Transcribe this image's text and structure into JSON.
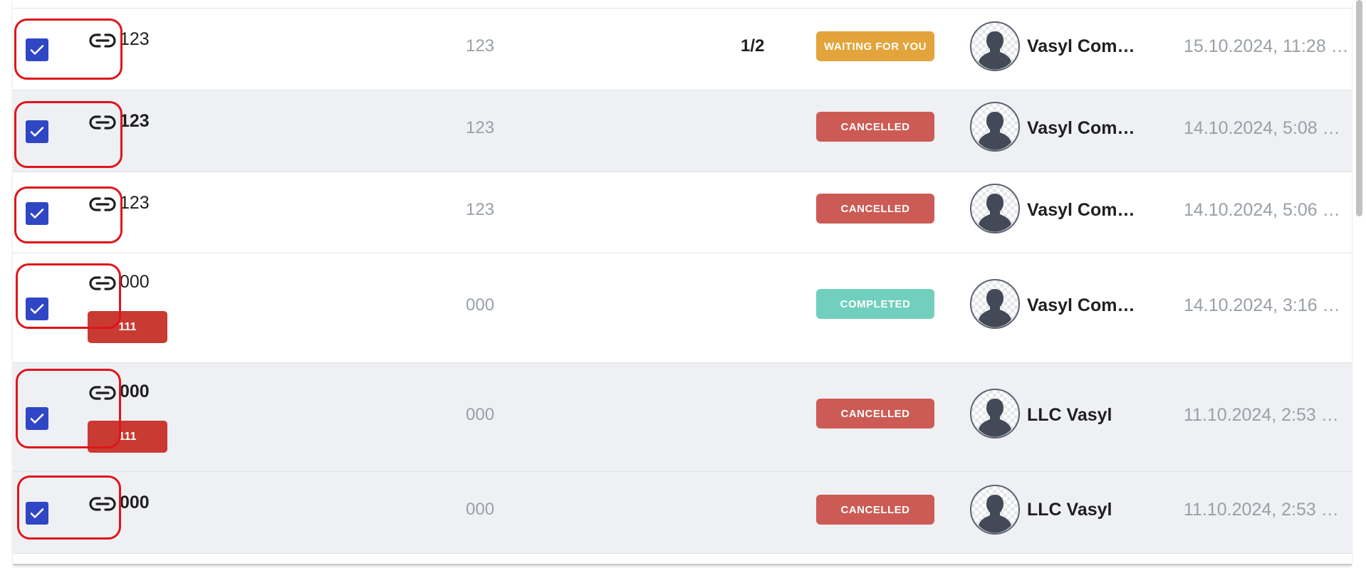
{
  "colors": {
    "checkbox": "#2f46c5",
    "waiting": "#e3a43c",
    "cancelled": "#cd5b55",
    "completed": "#70cfbd",
    "tag": "#c83a32",
    "annotation": "#e0151b"
  },
  "icons": {
    "checkbox": "checkmark-icon",
    "link": "link-icon",
    "avatar": "user-silhouette-icon"
  },
  "rows": [
    {
      "name": "123",
      "ref": "123",
      "progress": "1/2",
      "status": "WAITING FOR YOU",
      "owner": "Vasyl Com…",
      "date": "15.10.2024, 11:28 …"
    },
    {
      "name": "123",
      "ref": "123",
      "status": "CANCELLED",
      "owner": "Vasyl Com…",
      "date": "14.10.2024, 5:08 …"
    },
    {
      "name": "123",
      "ref": "123",
      "status": "CANCELLED",
      "owner": "Vasyl Com…",
      "date": "14.10.2024, 5:06 …"
    },
    {
      "name": "000",
      "tag": "111",
      "ref": "000",
      "status": "COMPLETED",
      "owner": "Vasyl Com…",
      "date": "14.10.2024, 3:16 …"
    },
    {
      "name": "000",
      "tag": "111",
      "ref": "000",
      "status": "CANCELLED",
      "owner": "LLC Vasyl",
      "date": "11.10.2024, 2:53 …"
    },
    {
      "name": "000",
      "ref": "000",
      "status": "CANCELLED",
      "owner": "LLC Vasyl",
      "date": "11.10.2024, 2:53 …"
    }
  ]
}
